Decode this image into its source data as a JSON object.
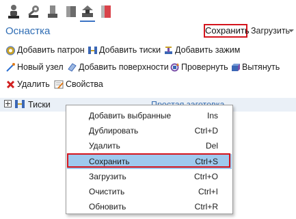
{
  "toolbar": {
    "icons": [
      "person-icon",
      "wrench-gear-icon",
      "cylinder-icon",
      "cube-icon",
      "fixture-icon",
      "red-block-icon"
    ]
  },
  "header": {
    "title": "Оснастка",
    "save_label": "Сохранить",
    "load_label": "Загрузить"
  },
  "actions": {
    "add_chuck": "Добавить патрон",
    "add_vise": "Добавить тиски",
    "add_clamp": "Добавить зажим",
    "new_node": "Новый узел",
    "add_surface": "Добавить поверхности",
    "rotate": "Провернуть",
    "extrude": "Вытянуть",
    "delete": "Удалить",
    "properties": "Свойства"
  },
  "tree": {
    "item_label": "Тиски",
    "item_type": "Простая заготовка"
  },
  "context_menu": {
    "items": [
      {
        "label": "Добавить выбранные",
        "shortcut": "Ins"
      },
      {
        "label": "Дублировать",
        "shortcut": "Ctrl+D"
      },
      {
        "label": "Удалить",
        "shortcut": "Del"
      },
      {
        "label": "Сохранить",
        "shortcut": "Ctrl+S",
        "highlighted": true
      },
      {
        "label": "Загрузить",
        "shortcut": "Ctrl+O"
      },
      {
        "label": "Очистить",
        "shortcut": "Ctrl+I"
      },
      {
        "label": "Обновить",
        "shortcut": "Ctrl+R"
      }
    ]
  },
  "colors": {
    "accent": "#2f6db4",
    "highlight": "#9ec9ee",
    "callout": "#d4141c",
    "tree_row": "#eaf0f7"
  }
}
